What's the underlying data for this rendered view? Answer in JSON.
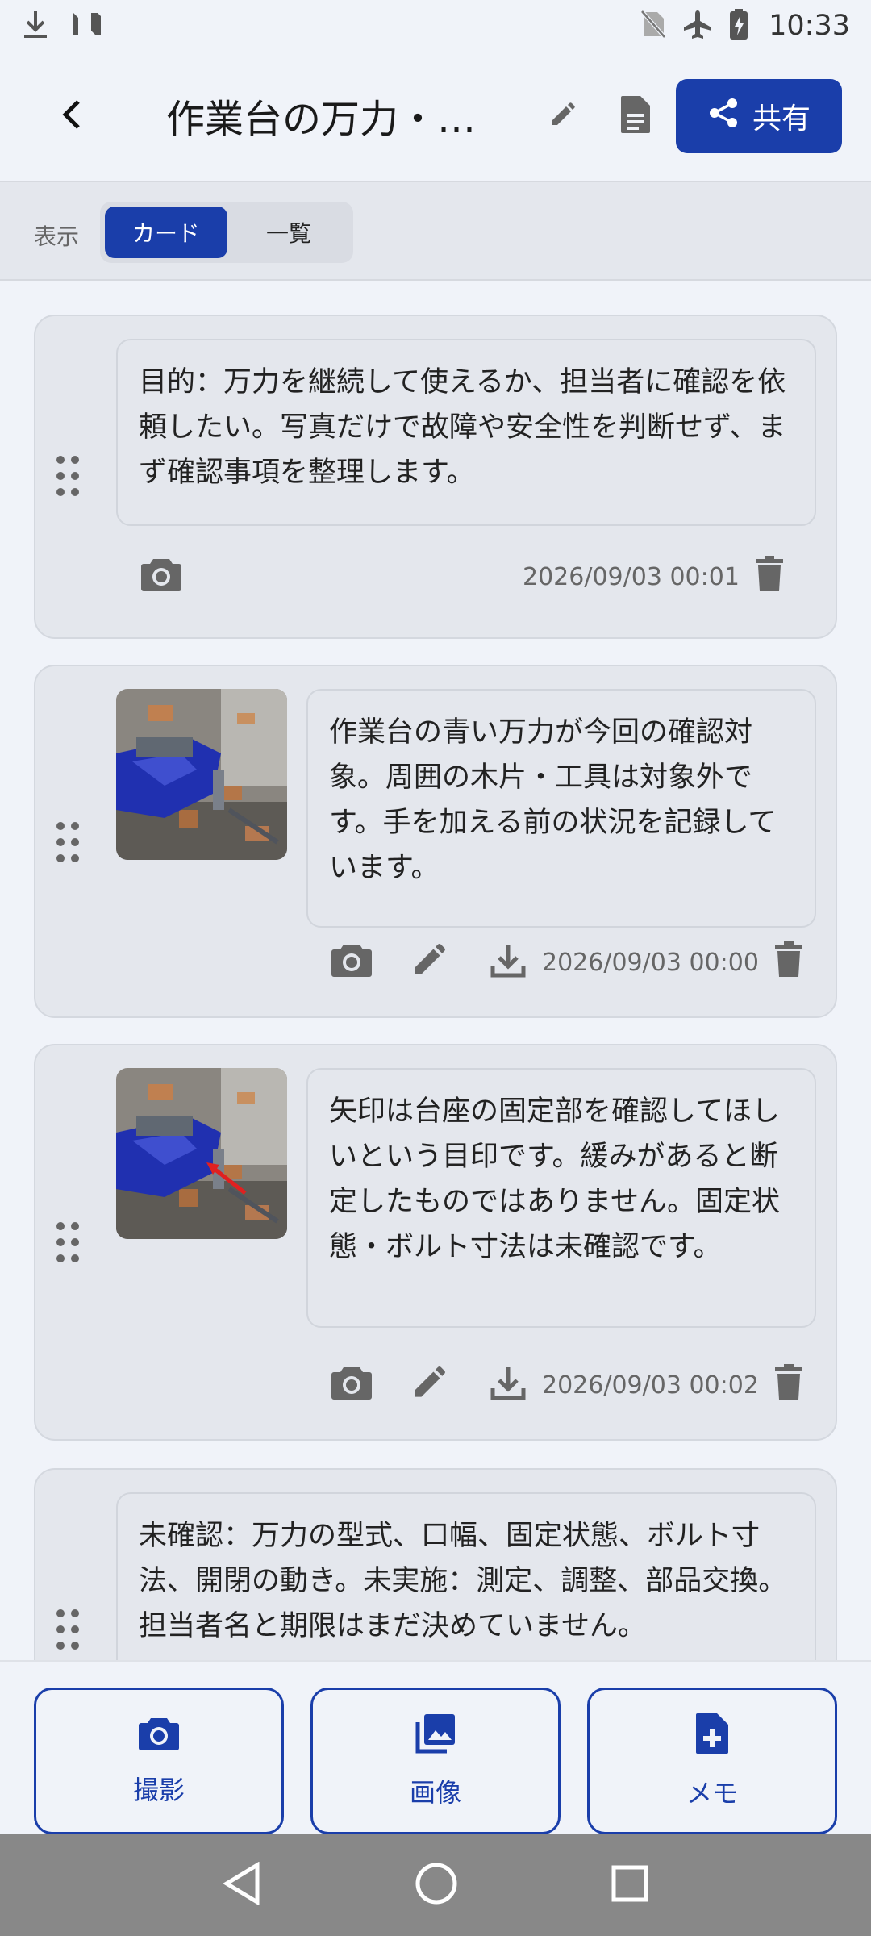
{
  "status_bar": {
    "time": "10:33"
  },
  "header": {
    "title": "作業台の万力・確…",
    "share_label": "共有"
  },
  "toolbar": {
    "view_label": "表示",
    "card_label": "カード",
    "list_label": "一覧"
  },
  "cards": [
    {
      "text": "目的：万力を継続して使えるか、担当者に確認を依頼したい。写真だけで故障や安全性を判断せず、まず確認事項を整理します。",
      "timestamp": "2026/09/03 00:01"
    },
    {
      "text": "作業台の青い万力が今回の確認対象。周囲の木片・工具は対象外です。手を加える前の状況を記録しています。",
      "timestamp": "2026/09/03 00:00"
    },
    {
      "text": "矢印は台座の固定部を確認してほしいという目印です。緩みがあると断定したものではありません。固定状態・ボルト寸法は未確認です。",
      "timestamp": "2026/09/03 00:02"
    },
    {
      "text": "未確認：万力の型式、口幅、固定状態、ボルト寸法、開閉の動き。未実施：測定、調整、部品交換。担当者名と期限はまだ決めていません。"
    }
  ],
  "bottom_actions": {
    "camera_label": "撮影",
    "image_label": "画像",
    "memo_label": "メモ"
  },
  "colors": {
    "primary": "#1a3eaa",
    "background": "#f0f3f9",
    "card": "#e4e7ed",
    "icon": "#666666"
  }
}
